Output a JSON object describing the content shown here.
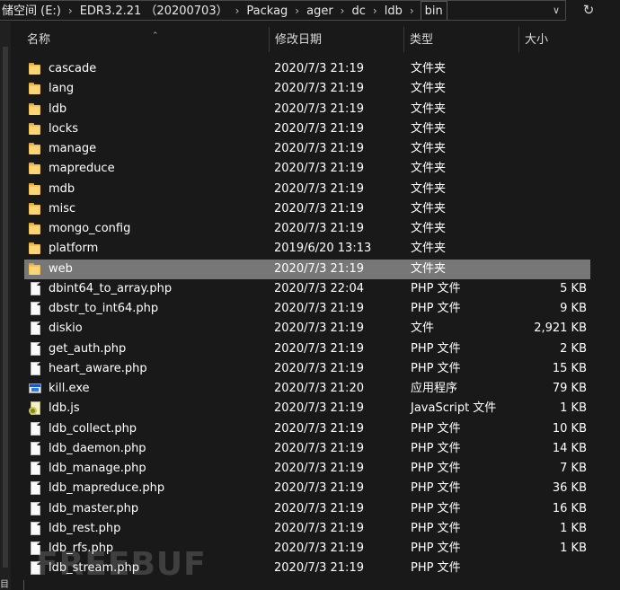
{
  "address": {
    "segments": [
      "储空间 (E:)",
      "EDR3.2.21 （20200703）",
      "Packag",
      "ager",
      "dc",
      "ldb",
      "bin"
    ],
    "blurred_segment": "Packag▒▒▒▒ ▒▒ ▒ ▒▒▒",
    "dropdown_icon": "chevron-down-icon",
    "refresh_icon": "refresh-icon"
  },
  "columns": {
    "name": "名称",
    "date": "修改日期",
    "type": "类型",
    "size": "大小"
  },
  "files": [
    {
      "name": "cascade",
      "date": "2020/7/3 21:19",
      "type": "文件夹",
      "size": "",
      "icon": "folder-icon"
    },
    {
      "name": "lang",
      "date": "2020/7/3 21:19",
      "type": "文件夹",
      "size": "",
      "icon": "folder-icon"
    },
    {
      "name": "ldb",
      "date": "2020/7/3 21:19",
      "type": "文件夹",
      "size": "",
      "icon": "folder-icon"
    },
    {
      "name": "locks",
      "date": "2020/7/3 21:19",
      "type": "文件夹",
      "size": "",
      "icon": "folder-icon"
    },
    {
      "name": "manage",
      "date": "2020/7/3 21:19",
      "type": "文件夹",
      "size": "",
      "icon": "folder-icon"
    },
    {
      "name": "mapreduce",
      "date": "2020/7/3 21:19",
      "type": "文件夹",
      "size": "",
      "icon": "folder-icon"
    },
    {
      "name": "mdb",
      "date": "2020/7/3 21:19",
      "type": "文件夹",
      "size": "",
      "icon": "folder-icon"
    },
    {
      "name": "misc",
      "date": "2020/7/3 21:19",
      "type": "文件夹",
      "size": "",
      "icon": "folder-icon"
    },
    {
      "name": "mongo_config",
      "date": "2020/7/3 21:19",
      "type": "文件夹",
      "size": "",
      "icon": "folder-icon"
    },
    {
      "name": "platform",
      "date": "2019/6/20 13:13",
      "type": "文件夹",
      "size": "",
      "icon": "folder-icon"
    },
    {
      "name": "web",
      "date": "2020/7/3 21:19",
      "type": "文件夹",
      "size": "",
      "icon": "folder-icon",
      "selected": true
    },
    {
      "name": "dbint64_to_array.php",
      "date": "2020/7/3 22:04",
      "type": "PHP 文件",
      "size": "5 KB",
      "icon": "file-icon"
    },
    {
      "name": "dbstr_to_int64.php",
      "date": "2020/7/3 21:19",
      "type": "PHP 文件",
      "size": "9 KB",
      "icon": "file-icon"
    },
    {
      "name": "diskio",
      "date": "2020/7/3 21:19",
      "type": "文件",
      "size": "2,921 KB",
      "icon": "file-icon"
    },
    {
      "name": "get_auth.php",
      "date": "2020/7/3 21:19",
      "type": "PHP 文件",
      "size": "2 KB",
      "icon": "file-icon"
    },
    {
      "name": "heart_aware.php",
      "date": "2020/7/3 21:19",
      "type": "PHP 文件",
      "size": "15 KB",
      "icon": "file-icon"
    },
    {
      "name": "kill.exe",
      "date": "2020/7/3 21:20",
      "type": "应用程序",
      "size": "79 KB",
      "icon": "exe-icon"
    },
    {
      "name": "ldb.js",
      "date": "2020/7/3 21:19",
      "type": "JavaScript 文件",
      "size": "1 KB",
      "icon": "js-icon"
    },
    {
      "name": "ldb_collect.php",
      "date": "2020/7/3 21:19",
      "type": "PHP 文件",
      "size": "10 KB",
      "icon": "file-icon"
    },
    {
      "name": "ldb_daemon.php",
      "date": "2020/7/3 21:19",
      "type": "PHP 文件",
      "size": "14 KB",
      "icon": "file-icon"
    },
    {
      "name": "ldb_manage.php",
      "date": "2020/7/3 21:19",
      "type": "PHP 文件",
      "size": "7 KB",
      "icon": "file-icon"
    },
    {
      "name": "ldb_mapreduce.php",
      "date": "2020/7/3 21:19",
      "type": "PHP 文件",
      "size": "36 KB",
      "icon": "file-icon"
    },
    {
      "name": "ldb_master.php",
      "date": "2020/7/3 21:19",
      "type": "PHP 文件",
      "size": "16 KB",
      "icon": "file-icon"
    },
    {
      "name": "ldb_rest.php",
      "date": "2020/7/3 21:19",
      "type": "PHP 文件",
      "size": "1 KB",
      "icon": "file-icon"
    },
    {
      "name": "ldb_rfs.php",
      "date": "2020/7/3 21:19",
      "type": "PHP 文件",
      "size": "1 KB",
      "icon": "file-icon"
    },
    {
      "name": "ldb_stream.php",
      "date": "2020/7/3 21:19",
      "type": "PHP 文件",
      "size": "",
      "icon": "file-icon"
    }
  ],
  "watermark": "FREEBUF",
  "status": {
    "text": "目"
  },
  "colors": {
    "background": "#191919",
    "selection": "#777777",
    "folder": "#f2c056",
    "text": "#ffffff"
  }
}
